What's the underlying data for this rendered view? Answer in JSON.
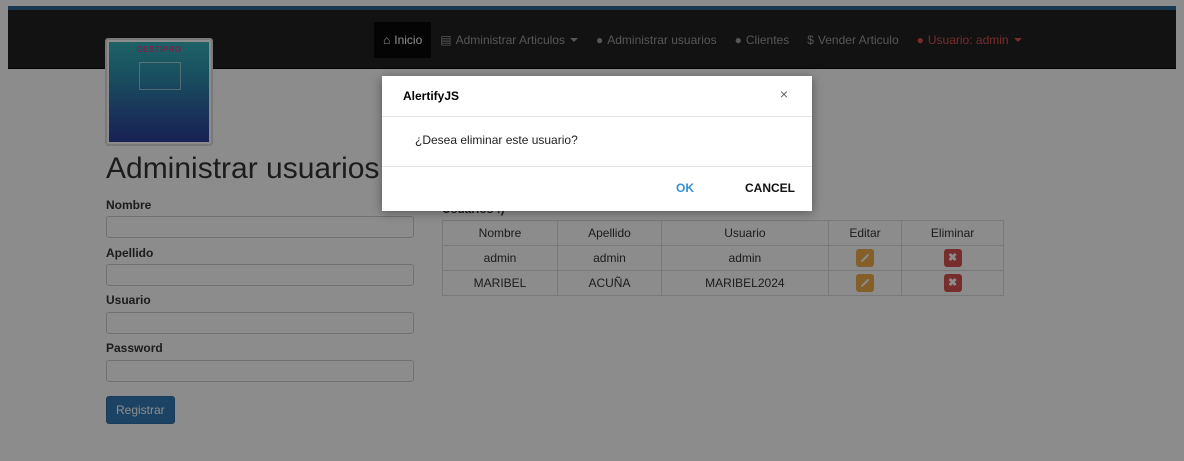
{
  "navbar": {
    "items": [
      {
        "label": "Inicio",
        "icon": "home-icon",
        "active": true
      },
      {
        "label": "Administrar Articulos",
        "icon": "list-icon",
        "dropdown": true
      },
      {
        "label": "Administrar usuarios",
        "icon": "user-icon"
      },
      {
        "label": "Clientes",
        "icon": "user-icon"
      },
      {
        "label": "Vender Articulo",
        "icon": "dollar-icon"
      },
      {
        "label": "Usuario: admin",
        "icon": "user-icon",
        "dropdown": true
      }
    ]
  },
  "logo": {
    "text": "GESTIPRO"
  },
  "page": {
    "title": "Administrar usuarios"
  },
  "form": {
    "nombre_label": "Nombre",
    "apellido_label": "Apellido",
    "usuario_label": "Usuario",
    "password_label": "Password",
    "submit_label": "Registrar"
  },
  "table": {
    "caption": "Usuarios :)",
    "headers": [
      "Nombre",
      "Apellido",
      "Usuario",
      "Editar",
      "Eliminar"
    ],
    "rows": [
      {
        "nombre": "admin",
        "apellido": "admin",
        "usuario": "admin"
      },
      {
        "nombre": "MARIBEL",
        "apellido": "ACUÑA",
        "usuario": "MARIBEL2024"
      }
    ]
  },
  "dialog": {
    "title": "AlertifyJS",
    "close_symbol": "×",
    "message": "¿Desea eliminar este usuario?",
    "ok_label": "OK",
    "cancel_label": "CANCEL"
  },
  "colors": {
    "navbar_bg": "#222222",
    "primary": "#337ab7",
    "warning": "#f0ad4e",
    "danger": "#d9534f",
    "dialog_ok": "#3593d2"
  }
}
